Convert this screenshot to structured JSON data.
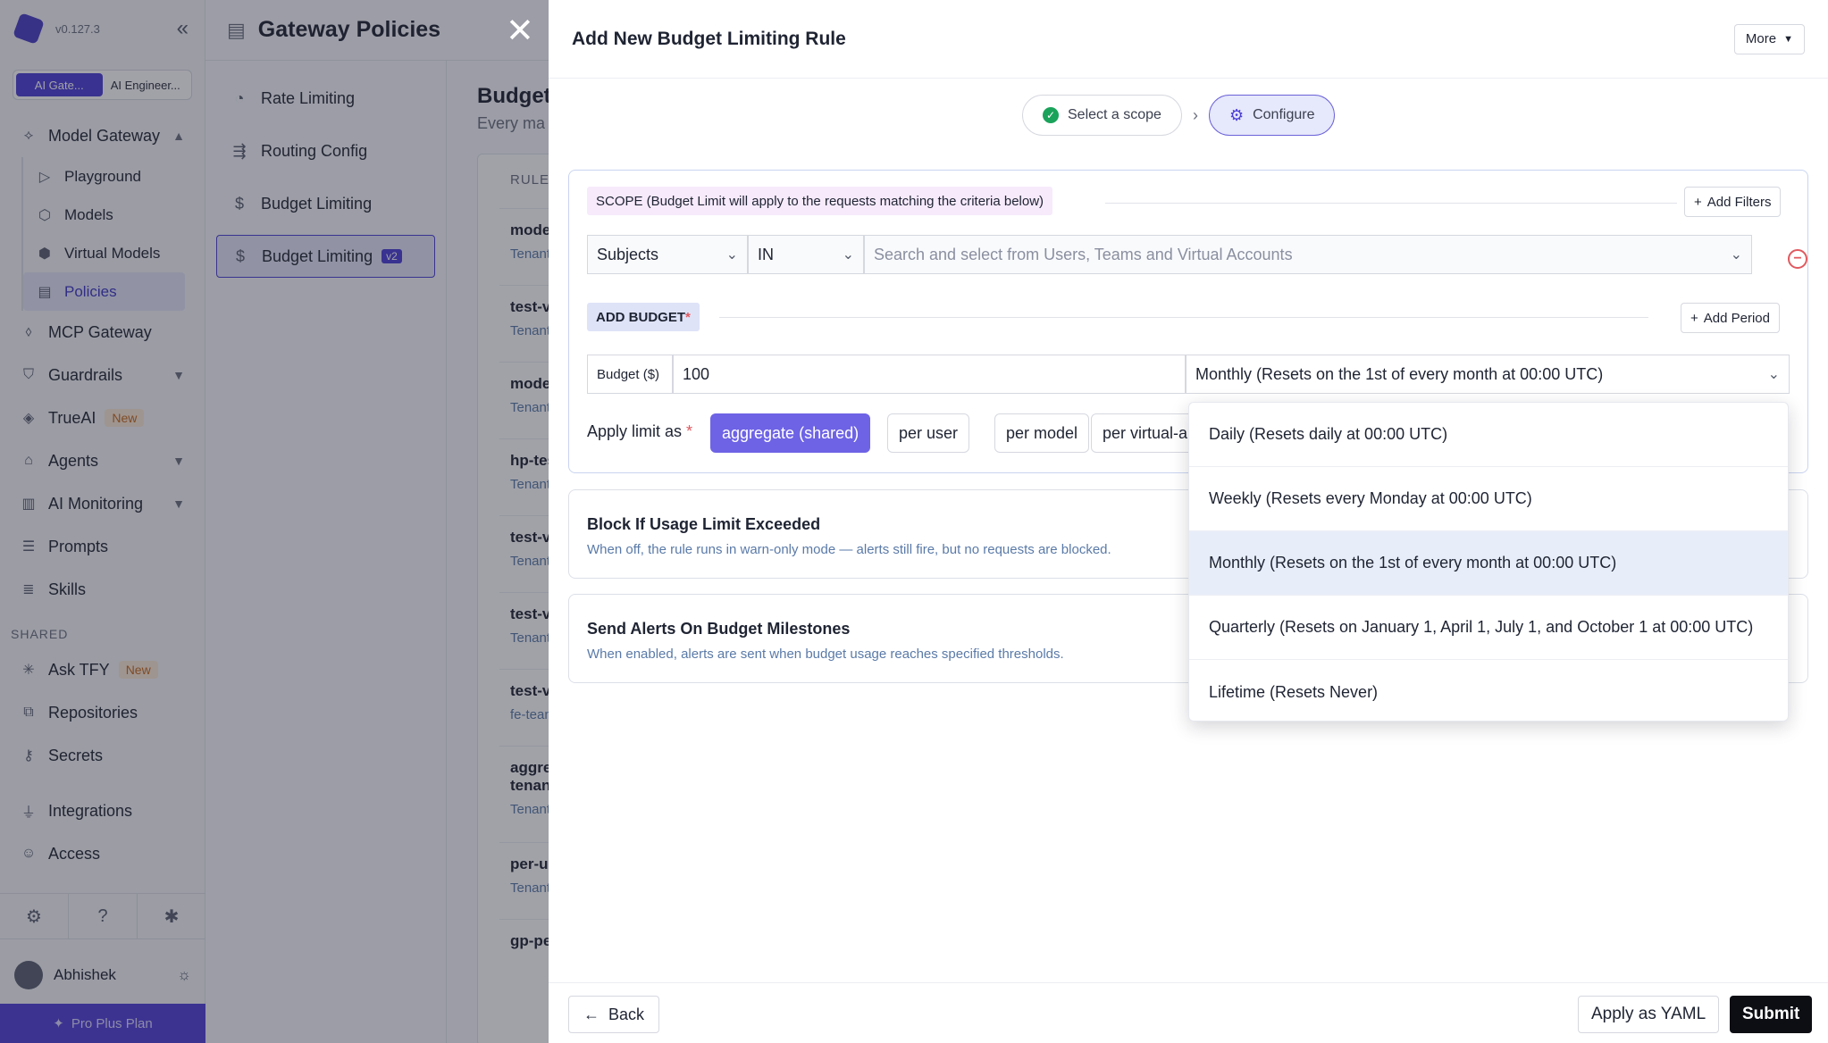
{
  "sidebar": {
    "version": "v0.127.3",
    "switch": [
      "AI Gate...",
      "AI Engineer..."
    ],
    "model_gateway": "Model Gateway",
    "model_gateway_items": [
      "Playground",
      "Models",
      "Virtual Models",
      "Policies"
    ],
    "items": [
      {
        "label": "MCP Gateway",
        "icon": "mcp-icon"
      },
      {
        "label": "Guardrails",
        "icon": "shield-icon"
      },
      {
        "label": "TrueAI",
        "icon": "cube-icon",
        "badge": "New"
      },
      {
        "label": "Agents",
        "icon": "robot-icon"
      },
      {
        "label": "AI Monitoring",
        "icon": "chart-icon"
      },
      {
        "label": "Prompts",
        "icon": "stack-icon"
      },
      {
        "label": "Skills",
        "icon": "list-icon"
      }
    ],
    "shared_section": "SHARED",
    "shared_items": [
      {
        "label": "Ask TFY",
        "badge": "New"
      },
      {
        "label": "Repositories"
      },
      {
        "label": "Secrets"
      }
    ],
    "bottom_items": [
      "Integrations",
      "Access"
    ],
    "user_name": "Abhishek",
    "plan": "Pro Plus Plan"
  },
  "gateway": {
    "title": "Gateway Policies",
    "nav": [
      "Rate Limiting",
      "Routing Config",
      "Budget Limiting",
      "Budget Limiting"
    ],
    "v2_badge": "v2",
    "main_title": "Budget",
    "main_sub": "Every ma",
    "rules_header": "RULE",
    "rules": [
      {
        "name": "model",
        "sub": "Tenant"
      },
      {
        "name": "test-v",
        "sub": "Tenant"
      },
      {
        "name": "model",
        "sub": "Tenant"
      },
      {
        "name": "hp-tes",
        "sub": "Tenant"
      },
      {
        "name": "test-v",
        "sub": "Tenant"
      },
      {
        "name": "test-v",
        "sub": "Tenant"
      },
      {
        "name": "test-v",
        "sub": "fe-tean"
      },
      {
        "name": "aggre",
        "name2": "tenan",
        "sub": "Tenant"
      },
      {
        "name": "per-us",
        "sub": "Tenant"
      },
      {
        "name": "gp-pe",
        "sub": ""
      }
    ]
  },
  "modal": {
    "title": "Add New Budget Limiting Rule",
    "more": "More",
    "steps": [
      "Select a scope",
      "Configure"
    ],
    "scope_label": "SCOPE (Budget Limit will apply to the requests matching the criteria below)",
    "add_filters": "Add Filters",
    "subject_field": "Subjects",
    "operator_field": "IN",
    "search_placeholder": "Search and select from Users, Teams and Virtual Accounts",
    "add_budget_label": "ADD BUDGET",
    "required_mark": "*",
    "add_period": "Add Period",
    "budget_label": "Budget ($)",
    "budget_value": "100",
    "period_value": "Monthly (Resets on the 1st of every month at 00:00 UTC)",
    "apply_limit_label": "Apply limit as",
    "apply_options": [
      "aggregate (shared)",
      "per user",
      "per model",
      "per virtual-a"
    ],
    "block_title": "Block If Usage Limit Exceeded",
    "block_desc": "When off, the rule runs in warn-only mode — alerts still fire, but no requests are blocked.",
    "alerts_title": "Send Alerts On Budget Milestones",
    "alerts_desc": "When enabled, alerts are sent when budget usage reaches specified thresholds.",
    "period_options": [
      "Daily (Resets daily at 00:00 UTC)",
      "Weekly (Resets every Monday at 00:00 UTC)",
      "Monthly (Resets on the 1st of every month at 00:00 UTC)",
      "Quarterly (Resets on January 1, April 1, July 1, and October 1 at 00:00 UTC)",
      "Lifetime (Resets Never)"
    ],
    "back": "Back",
    "apply_yaml": "Apply as YAML",
    "submit": "Submit"
  }
}
